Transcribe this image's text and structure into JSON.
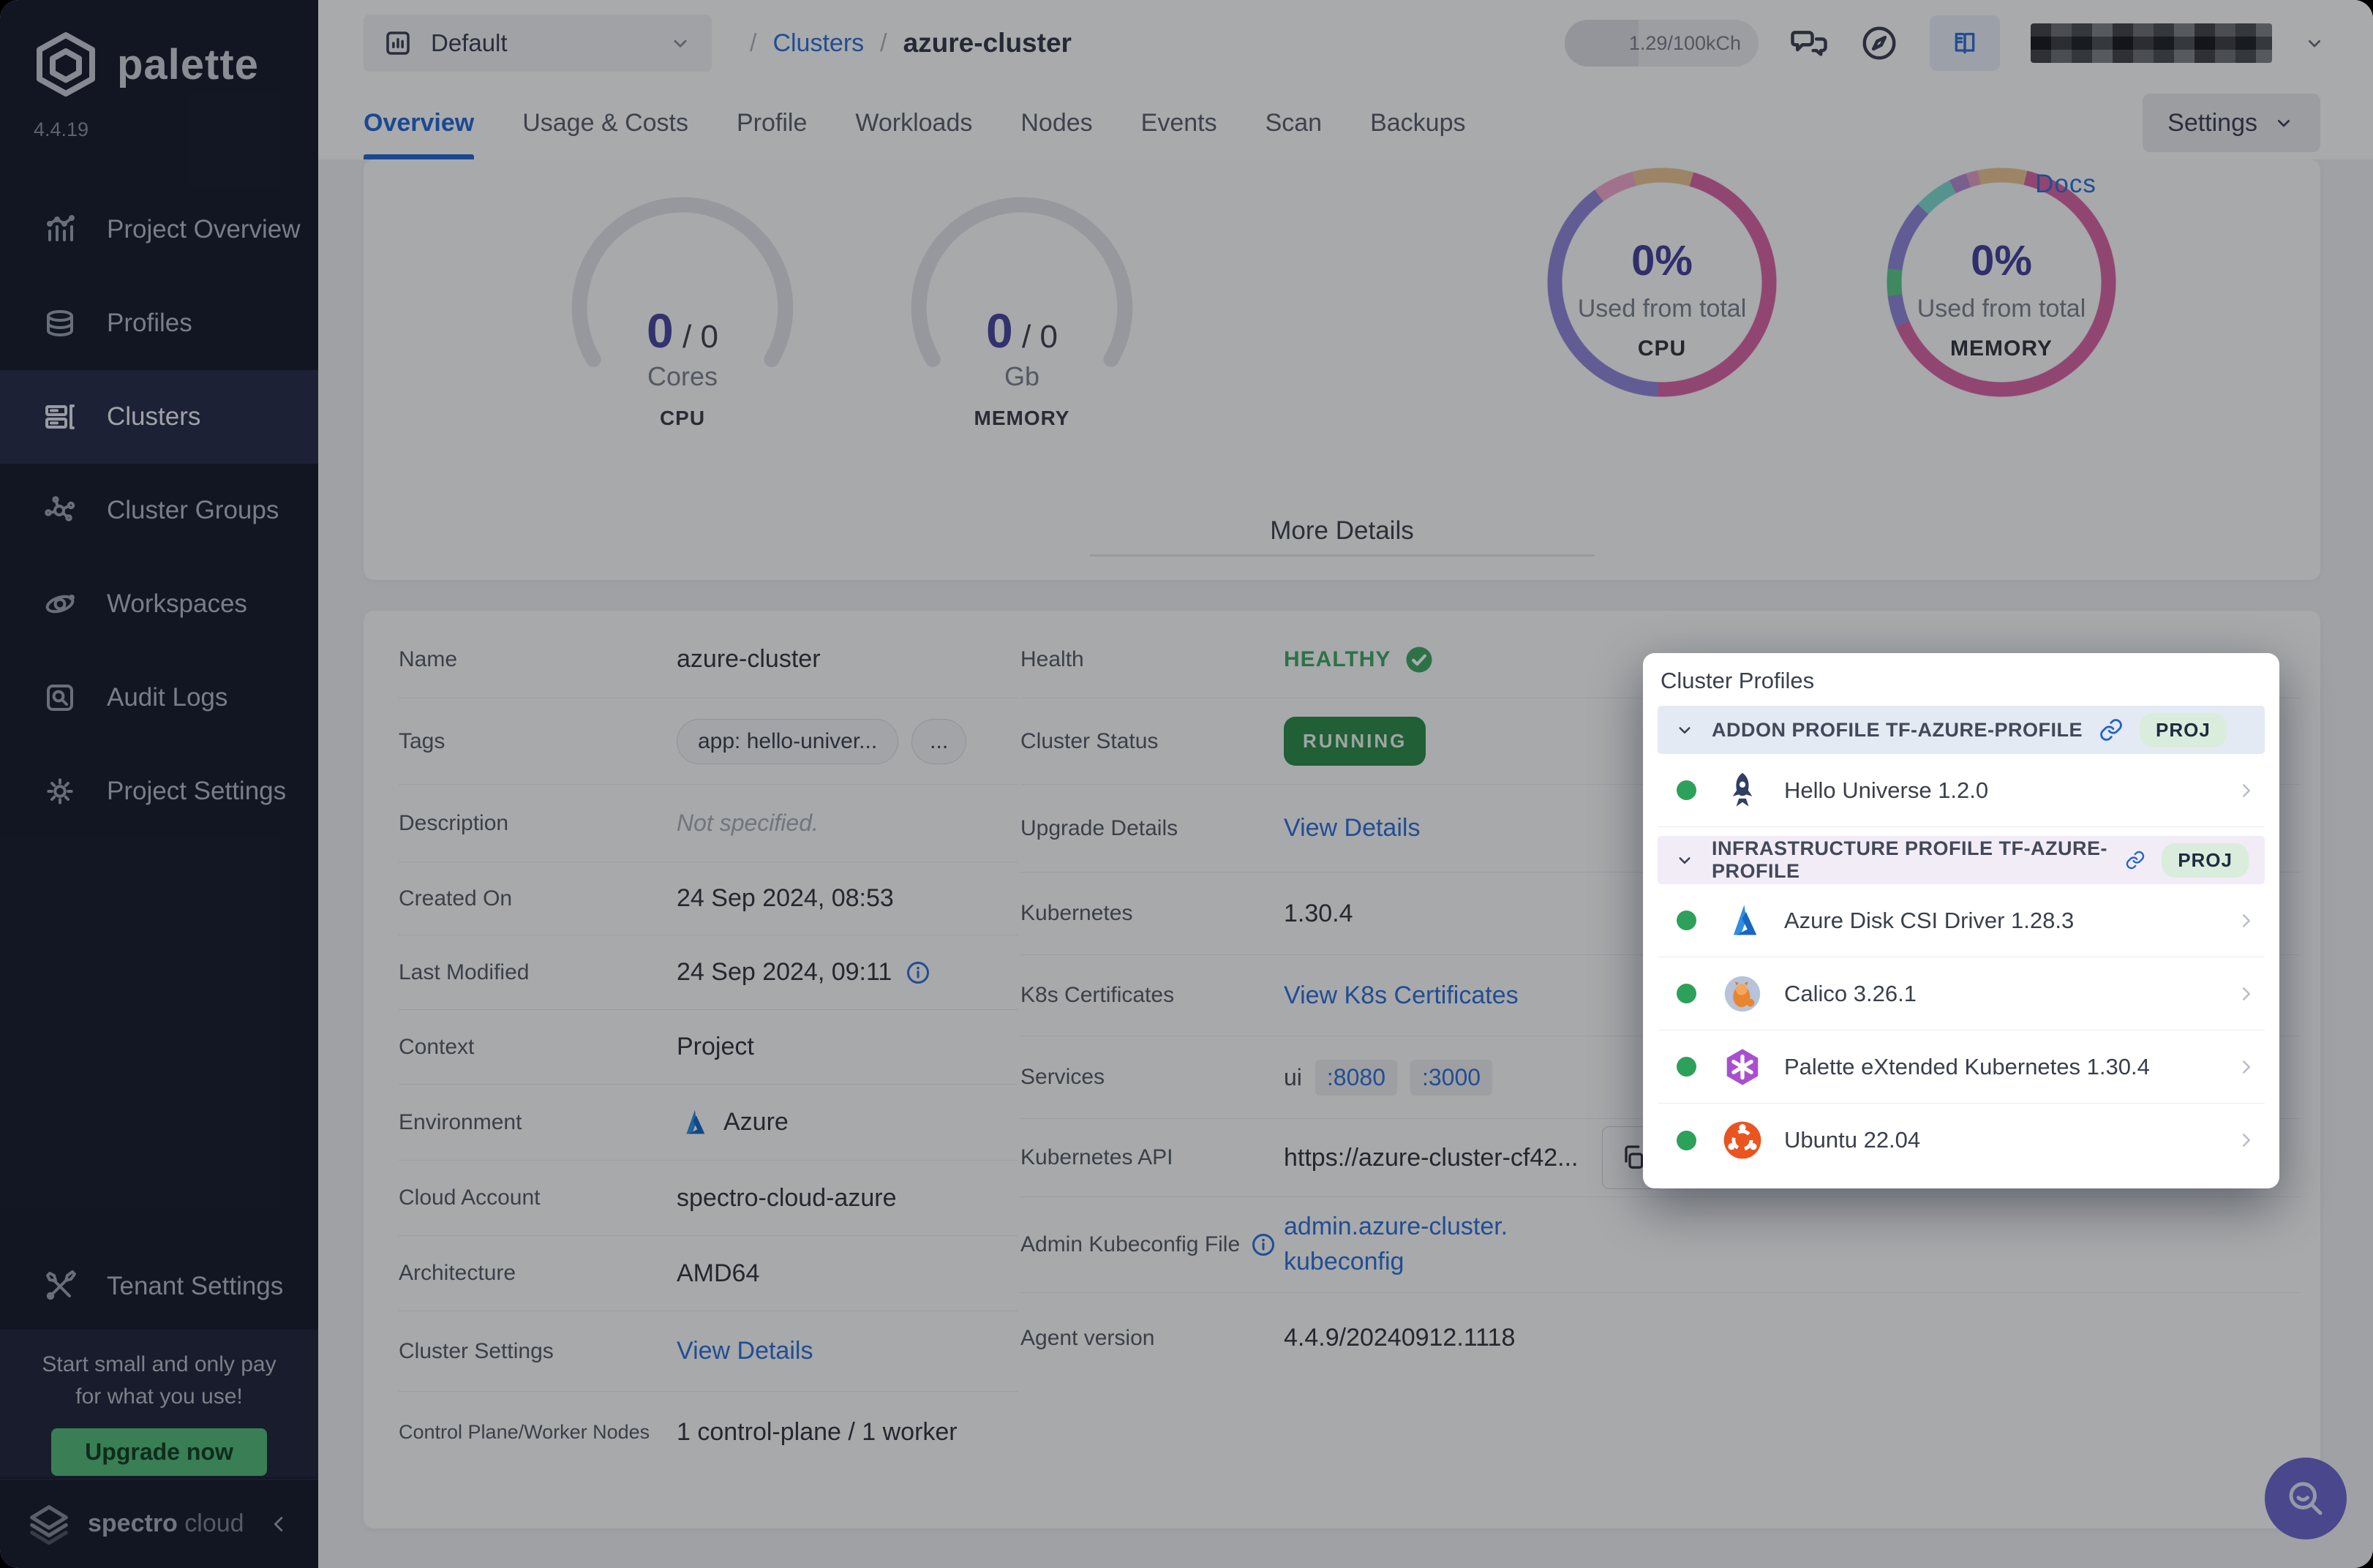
{
  "sidebar": {
    "brand": "palette",
    "version": "4.4.19",
    "items": [
      "Project Overview",
      "Profiles",
      "Clusters",
      "Cluster Groups",
      "Workspaces",
      "Audit Logs",
      "Project Settings"
    ],
    "active_item": "Clusters",
    "tenant_settings": "Tenant Settings",
    "promo_line1": "Start small and only pay",
    "promo_line2": "for what you use!",
    "upgrade_label": "Upgrade now",
    "footer_brand_bold": "spectro",
    "footer_brand_light": "cloud"
  },
  "topbar": {
    "project_selector": "Default",
    "breadcrumb_sep": "/",
    "breadcrumb_root": "Clusters",
    "breadcrumb_current": "azure-cluster",
    "usage_meter": "1.29/100kCh",
    "docs_label": "Docs"
  },
  "tabs": {
    "items": [
      "Overview",
      "Usage & Costs",
      "Profile",
      "Workloads",
      "Nodes",
      "Events",
      "Scan",
      "Backups"
    ],
    "active": "Overview",
    "settings_label": "Settings"
  },
  "overview": {
    "cpu_gauge": {
      "used": "0",
      "sep": "/ ",
      "total": "0",
      "unit": "Cores",
      "caption": "CPU"
    },
    "memory_gauge": {
      "used": "0",
      "sep": "/ ",
      "total": "0",
      "unit": "Gb",
      "caption": "MEMORY"
    },
    "cpu_donut": {
      "percent": "0%",
      "caption": "Used from total",
      "label": "CPU"
    },
    "memory_donut": {
      "percent": "0%",
      "caption": "Used from total",
      "label": "MEMORY"
    },
    "more_details": "More Details"
  },
  "chart_data": [
    {
      "type": "pie",
      "title": "CPU used from total",
      "center_label": "0%",
      "sublabel": "Used from total",
      "caption": "CPU",
      "segments": [
        {
          "name": "tan",
          "value": 8.5,
          "color": "#e7c493"
        },
        {
          "name": "pink",
          "value": 50.5,
          "color": "#d864a4"
        },
        {
          "name": "purple",
          "value": 39.2,
          "color": "#8f86d8"
        },
        {
          "name": "light-pink",
          "value": 1.8,
          "color": "#f0a8cd"
        }
      ]
    },
    {
      "type": "pie",
      "title": "Memory used from total",
      "center_label": "0%",
      "sublabel": "Used from total",
      "caption": "MEMORY",
      "segments": [
        {
          "name": "tan",
          "value": 7,
          "color": "#e7c493"
        },
        {
          "name": "pink",
          "value": 65,
          "color": "#d864a4"
        },
        {
          "name": "purple",
          "value": 4.5,
          "color": "#8f86d8"
        },
        {
          "name": "green",
          "value": 3.8,
          "color": "#5bc98b"
        },
        {
          "name": "purple-2",
          "value": 10,
          "color": "#8f86d8"
        },
        {
          "name": "teal",
          "value": 5.5,
          "color": "#7fd9d2"
        },
        {
          "name": "violet",
          "value": 2.5,
          "color": "#b48bd0"
        },
        {
          "name": "light-pink",
          "value": 1.7,
          "color": "#e39ec6"
        }
      ]
    },
    {
      "type": "gauge",
      "title": "CPU cores",
      "used": 0,
      "total": 0,
      "unit": "Cores",
      "caption": "CPU"
    },
    {
      "type": "gauge",
      "title": "Memory Gb",
      "used": 0,
      "total": 0,
      "unit": "Gb",
      "caption": "MEMORY"
    }
  ],
  "details": {
    "name": {
      "label": "Name",
      "value": "azure-cluster"
    },
    "tags": {
      "label": "Tags",
      "tag": "app: hello-univer...",
      "more": "..."
    },
    "description": {
      "label": "Description",
      "value": "Not specified."
    },
    "created_on": {
      "label": "Created On",
      "value": "24 Sep 2024, 08:53"
    },
    "last_modified": {
      "label": "Last Modified",
      "value": "24 Sep 2024, 09:11"
    },
    "context": {
      "label": "Context",
      "value": "Project"
    },
    "environment": {
      "label": "Environment",
      "value": "Azure"
    },
    "cloud_account": {
      "label": "Cloud Account",
      "value": "spectro-cloud-azure"
    },
    "architecture": {
      "label": "Architecture",
      "value": "AMD64"
    },
    "cluster_settings": {
      "label": "Cluster Settings",
      "value": "View Details"
    },
    "nodes": {
      "label": "Control Plane/Worker Nodes",
      "value": "1 control-plane / 1 worker"
    },
    "health": {
      "label": "Health",
      "value": "HEALTHY"
    },
    "cluster_status": {
      "label": "Cluster Status",
      "value": "RUNNING"
    },
    "upgrade_details": {
      "label": "Upgrade Details",
      "value": "View Details"
    },
    "kubernetes": {
      "label": "Kubernetes",
      "value": "1.30.4"
    },
    "k8s_certificates": {
      "label": "K8s Certificates",
      "value": "View K8s Certificates"
    },
    "services": {
      "label": "Services",
      "name": "ui",
      "port1": ":8080",
      "port2": ":3000"
    },
    "kubernetes_api": {
      "label": "Kubernetes API",
      "value": "https://azure-cluster-cf42..."
    },
    "admin_kubeconfig": {
      "label": "Admin Kubeconfig File",
      "value": "admin.azure-cluster.kubeconfig"
    },
    "agent_version": {
      "label": "Agent version",
      "value": "4.4.9/20240912.1118"
    }
  },
  "cluster_profiles": {
    "title": "Cluster Profiles",
    "sections": [
      {
        "name": "ADDON PROFILE TF-AZURE-PROFILE",
        "badge": "PROJ",
        "items": [
          {
            "name": "Hello Universe 1.2.0",
            "icon": "rocket-icon"
          }
        ]
      },
      {
        "name": "INFRASTRUCTURE PROFILE TF-AZURE-PROFILE",
        "badge": "PROJ",
        "items": [
          {
            "name": "Azure Disk CSI Driver 1.28.3",
            "icon": "azure-icon"
          },
          {
            "name": "Calico 3.26.1",
            "icon": "calico-cat-icon"
          },
          {
            "name": "Palette eXtended Kubernetes 1.30.4",
            "icon": "palette-hexagon-icon"
          },
          {
            "name": "Ubuntu 22.04",
            "icon": "ubuntu-icon"
          }
        ]
      }
    ]
  },
  "colors": {
    "accent_blue": "#2f6fd6",
    "healthy_green": "#41a763",
    "running_green": "#2e8b4d",
    "indigo": "#4a47a0",
    "fab_purple": "#6c66cf",
    "sidebar_bg": "#181c2e",
    "upgrade_green": "#53b97a"
  }
}
